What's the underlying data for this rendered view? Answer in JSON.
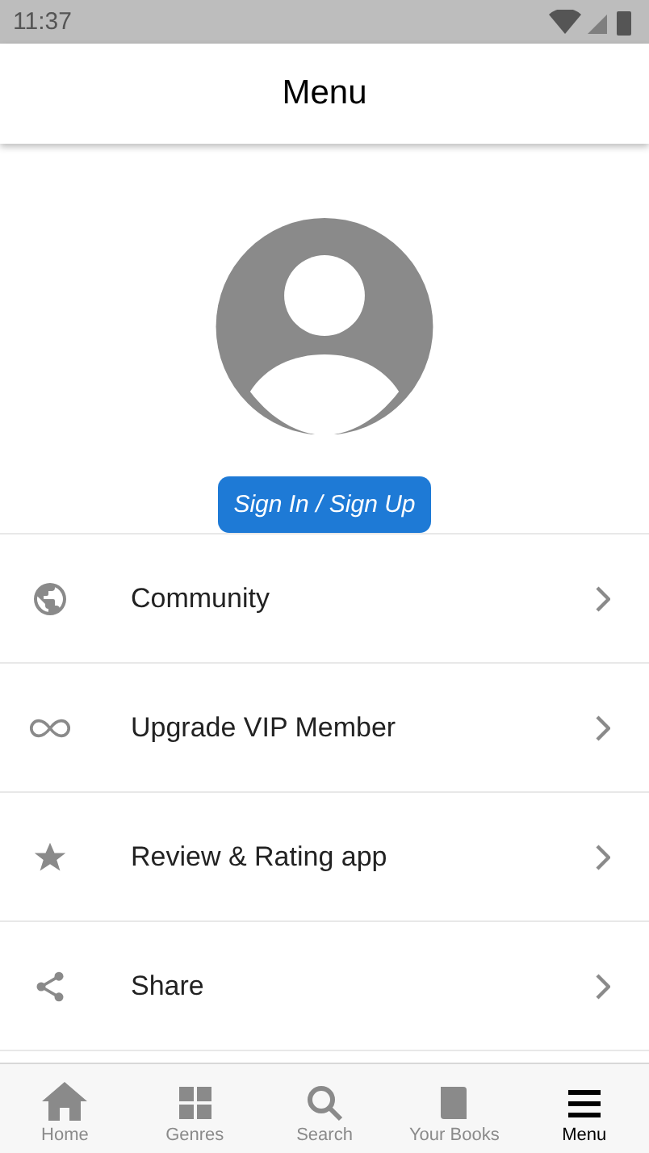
{
  "status_bar": {
    "time": "11:37"
  },
  "app_bar": {
    "title": "Menu"
  },
  "profile": {
    "button": "Sign In / Sign Up"
  },
  "menu_items": [
    {
      "label": "Community",
      "kind": "globe"
    },
    {
      "label": "Upgrade VIP Member",
      "kind": "infinity"
    },
    {
      "label": "Review & Rating app",
      "kind": "star"
    },
    {
      "label": "Share",
      "kind": "share"
    }
  ],
  "bottom_nav": [
    {
      "label": "Home",
      "kind": "home",
      "selected": false
    },
    {
      "label": "Genres",
      "kind": "genres",
      "selected": false
    },
    {
      "label": "Search",
      "kind": "search",
      "selected": false
    },
    {
      "label": "Your Books",
      "kind": "books",
      "selected": false
    },
    {
      "label": "Menu",
      "kind": "menu",
      "selected": true
    }
  ]
}
